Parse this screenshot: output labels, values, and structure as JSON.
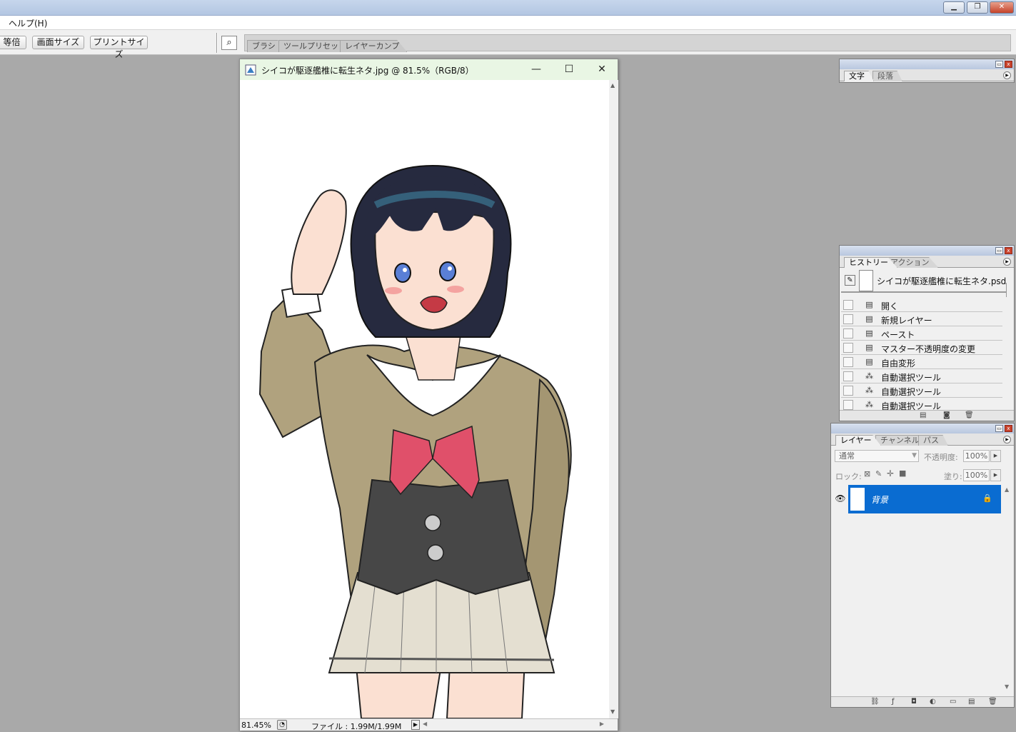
{
  "menubar": {
    "help": "ヘルプ(H)"
  },
  "optionsbar": {
    "actual_pixels": "等倍",
    "fit_screen": "画面サイズ",
    "print_size": "プリントサイズ",
    "tool_icon": "zoom-tool-icon",
    "well_tabs": [
      "ブラシ",
      "ツールプリセット",
      "レイヤーカンプ"
    ]
  },
  "document": {
    "title": "シイコが駆逐艦椎に転生ネタ.jpg @ 81.5%（RGB/8）",
    "zoom": "81.45%",
    "file_info": "ファイル : 1.99M/1.99M"
  },
  "character_palette": {
    "tabs": [
      "文字",
      "段落"
    ]
  },
  "history_palette": {
    "tabs": [
      "ヒストリー",
      "アクション"
    ],
    "snapshot": "シイコが駆逐艦椎に転生ネタ.psd",
    "steps": [
      {
        "label": "開く",
        "icon": "document-icon"
      },
      {
        "label": "新規レイヤー",
        "icon": "document-icon"
      },
      {
        "label": "ペースト",
        "icon": "document-icon"
      },
      {
        "label": "マスター不透明度の変更",
        "icon": "document-icon"
      },
      {
        "label": "自由変形",
        "icon": "document-icon"
      },
      {
        "label": "自動選択ツール",
        "icon": "magic-wand-icon"
      },
      {
        "label": "自動選択ツール",
        "icon": "magic-wand-icon"
      },
      {
        "label": "自動選択ツール",
        "icon": "magic-wand-icon"
      }
    ]
  },
  "layers_palette": {
    "tabs": [
      "レイヤー",
      "チャンネル",
      "パス"
    ],
    "blend_mode": "通常",
    "opacity_label": "不透明度:",
    "opacity": "100%",
    "lock_label": "ロック:",
    "fill_label": "塗り:",
    "fill": "100%",
    "layers": [
      {
        "name": "背景",
        "locked": true,
        "visible": true
      }
    ]
  },
  "colors": {
    "workspace": "#a9a9a9",
    "selection": "#0a6cd1",
    "doc_title_bg": "#e9f6e4"
  }
}
